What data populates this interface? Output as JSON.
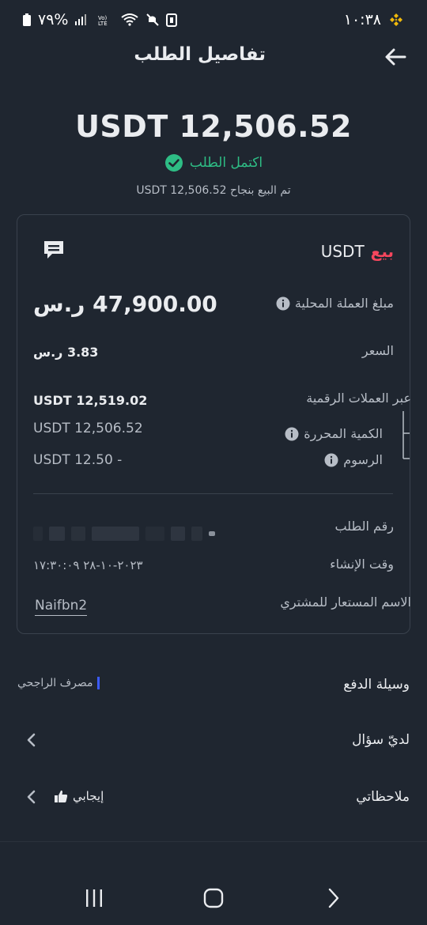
{
  "status_bar": {
    "battery": "٧٩%",
    "time": "١٠:٣٨"
  },
  "header": {
    "title": "تفاصيل الطلب"
  },
  "summary": {
    "amount": "USDT 12,506.52",
    "status": "اكتمل الطلب",
    "sold_text": "تم البيع بنجاح  USDT 12,506.52"
  },
  "card": {
    "side": "بيع",
    "asset": "USDT",
    "local_amount_label": "مبلغ العملة المحلية",
    "local_amount_value": "47,900.00 ر.س",
    "price_label": "السعر",
    "price_value": "3.83 ر.س",
    "crypto_label": "عبر العملات الرقمية",
    "crypto_value": "USDT 12,519.02",
    "released_label": "الكمية المحررة",
    "released_value": "USDT 12,506.52",
    "fees_label": "الرسوم",
    "fees_value": "USDT 12.50 -",
    "order_no_label": "رقم الطلب",
    "created_label": "وقت الإنشاء",
    "created_value": "٢٠٢٣-١٠-٢٨ ١٧:٣٠:٠٩",
    "buyer_label": "الاسم المستعار للمشتري",
    "buyer_value": "Naifbn2"
  },
  "payment": {
    "label": "وسيلة الدفع",
    "value": "مصرف الراجحي",
    "bank_color": "#3b5bff"
  },
  "question": {
    "label": "لديّ سؤال"
  },
  "notes": {
    "label": "ملاحظاتي",
    "value": "إيجابي"
  },
  "colors": {
    "background": "#1f2630",
    "sell": "#f6465d",
    "success": "#2ebd85",
    "binance": "#f0b90b"
  }
}
